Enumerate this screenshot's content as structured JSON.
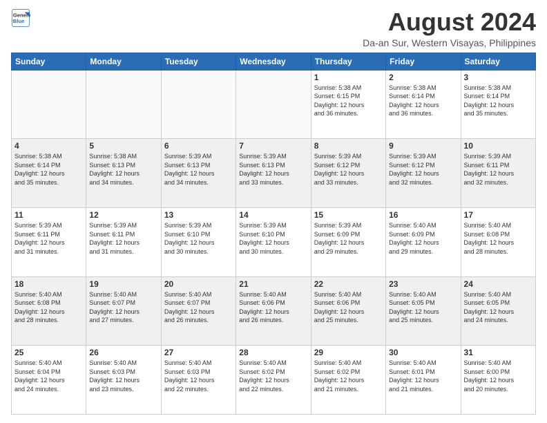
{
  "logo": {
    "line1": "General",
    "line2": "Blue"
  },
  "title": "August 2024",
  "location": "Da-an Sur, Western Visayas, Philippines",
  "days_header": [
    "Sunday",
    "Monday",
    "Tuesday",
    "Wednesday",
    "Thursday",
    "Friday",
    "Saturday"
  ],
  "weeks": [
    [
      {
        "day": "",
        "info": ""
      },
      {
        "day": "",
        "info": ""
      },
      {
        "day": "",
        "info": ""
      },
      {
        "day": "",
        "info": ""
      },
      {
        "day": "1",
        "info": "Sunrise: 5:38 AM\nSunset: 6:15 PM\nDaylight: 12 hours\nand 36 minutes."
      },
      {
        "day": "2",
        "info": "Sunrise: 5:38 AM\nSunset: 6:14 PM\nDaylight: 12 hours\nand 36 minutes."
      },
      {
        "day": "3",
        "info": "Sunrise: 5:38 AM\nSunset: 6:14 PM\nDaylight: 12 hours\nand 35 minutes."
      }
    ],
    [
      {
        "day": "4",
        "info": "Sunrise: 5:38 AM\nSunset: 6:14 PM\nDaylight: 12 hours\nand 35 minutes."
      },
      {
        "day": "5",
        "info": "Sunrise: 5:38 AM\nSunset: 6:13 PM\nDaylight: 12 hours\nand 34 minutes."
      },
      {
        "day": "6",
        "info": "Sunrise: 5:39 AM\nSunset: 6:13 PM\nDaylight: 12 hours\nand 34 minutes."
      },
      {
        "day": "7",
        "info": "Sunrise: 5:39 AM\nSunset: 6:13 PM\nDaylight: 12 hours\nand 33 minutes."
      },
      {
        "day": "8",
        "info": "Sunrise: 5:39 AM\nSunset: 6:12 PM\nDaylight: 12 hours\nand 33 minutes."
      },
      {
        "day": "9",
        "info": "Sunrise: 5:39 AM\nSunset: 6:12 PM\nDaylight: 12 hours\nand 32 minutes."
      },
      {
        "day": "10",
        "info": "Sunrise: 5:39 AM\nSunset: 6:11 PM\nDaylight: 12 hours\nand 32 minutes."
      }
    ],
    [
      {
        "day": "11",
        "info": "Sunrise: 5:39 AM\nSunset: 6:11 PM\nDaylight: 12 hours\nand 31 minutes."
      },
      {
        "day": "12",
        "info": "Sunrise: 5:39 AM\nSunset: 6:11 PM\nDaylight: 12 hours\nand 31 minutes."
      },
      {
        "day": "13",
        "info": "Sunrise: 5:39 AM\nSunset: 6:10 PM\nDaylight: 12 hours\nand 30 minutes."
      },
      {
        "day": "14",
        "info": "Sunrise: 5:39 AM\nSunset: 6:10 PM\nDaylight: 12 hours\nand 30 minutes."
      },
      {
        "day": "15",
        "info": "Sunrise: 5:39 AM\nSunset: 6:09 PM\nDaylight: 12 hours\nand 29 minutes."
      },
      {
        "day": "16",
        "info": "Sunrise: 5:40 AM\nSunset: 6:09 PM\nDaylight: 12 hours\nand 29 minutes."
      },
      {
        "day": "17",
        "info": "Sunrise: 5:40 AM\nSunset: 6:08 PM\nDaylight: 12 hours\nand 28 minutes."
      }
    ],
    [
      {
        "day": "18",
        "info": "Sunrise: 5:40 AM\nSunset: 6:08 PM\nDaylight: 12 hours\nand 28 minutes."
      },
      {
        "day": "19",
        "info": "Sunrise: 5:40 AM\nSunset: 6:07 PM\nDaylight: 12 hours\nand 27 minutes."
      },
      {
        "day": "20",
        "info": "Sunrise: 5:40 AM\nSunset: 6:07 PM\nDaylight: 12 hours\nand 26 minutes."
      },
      {
        "day": "21",
        "info": "Sunrise: 5:40 AM\nSunset: 6:06 PM\nDaylight: 12 hours\nand 26 minutes."
      },
      {
        "day": "22",
        "info": "Sunrise: 5:40 AM\nSunset: 6:06 PM\nDaylight: 12 hours\nand 25 minutes."
      },
      {
        "day": "23",
        "info": "Sunrise: 5:40 AM\nSunset: 6:05 PM\nDaylight: 12 hours\nand 25 minutes."
      },
      {
        "day": "24",
        "info": "Sunrise: 5:40 AM\nSunset: 6:05 PM\nDaylight: 12 hours\nand 24 minutes."
      }
    ],
    [
      {
        "day": "25",
        "info": "Sunrise: 5:40 AM\nSunset: 6:04 PM\nDaylight: 12 hours\nand 24 minutes."
      },
      {
        "day": "26",
        "info": "Sunrise: 5:40 AM\nSunset: 6:03 PM\nDaylight: 12 hours\nand 23 minutes."
      },
      {
        "day": "27",
        "info": "Sunrise: 5:40 AM\nSunset: 6:03 PM\nDaylight: 12 hours\nand 22 minutes."
      },
      {
        "day": "28",
        "info": "Sunrise: 5:40 AM\nSunset: 6:02 PM\nDaylight: 12 hours\nand 22 minutes."
      },
      {
        "day": "29",
        "info": "Sunrise: 5:40 AM\nSunset: 6:02 PM\nDaylight: 12 hours\nand 21 minutes."
      },
      {
        "day": "30",
        "info": "Sunrise: 5:40 AM\nSunset: 6:01 PM\nDaylight: 12 hours\nand 21 minutes."
      },
      {
        "day": "31",
        "info": "Sunrise: 5:40 AM\nSunset: 6:00 PM\nDaylight: 12 hours\nand 20 minutes."
      }
    ]
  ]
}
